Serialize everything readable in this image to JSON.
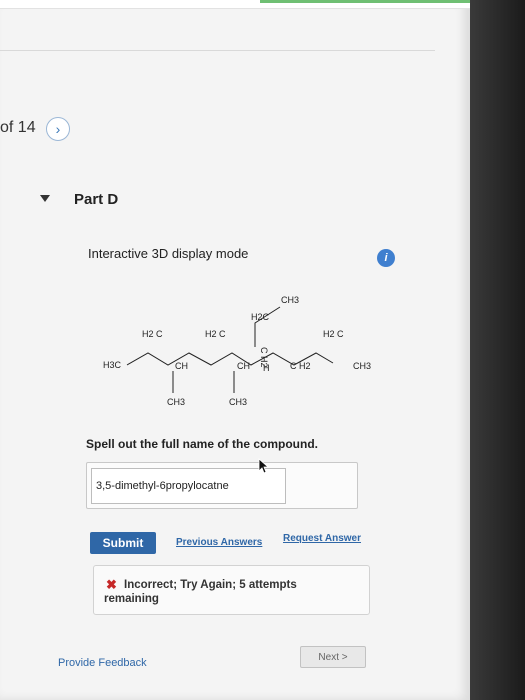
{
  "pager": {
    "current_label": "of 14"
  },
  "part": {
    "title": "Part D"
  },
  "display_mode": {
    "label": "Interactive 3D display mode",
    "info_icon": "i"
  },
  "molecule": {
    "labels": {
      "h3c_left": "H3C",
      "ch2_a": "H2 C",
      "ch_a": "CH",
      "ch3_a": "CH3",
      "ch2_b": "H2 C",
      "ch_b": "CH",
      "ch3_b": "CH3",
      "h2c_top": "H2C",
      "ch3_top": "CH3",
      "c_mid": "C H2",
      "h_mid": "H",
      "c_low": "C H2",
      "ch2_right": "H2 C",
      "ch3_right": "CH3"
    }
  },
  "question": {
    "prompt": "Spell out the full name of the compound."
  },
  "answer": {
    "value": "3,5-dimethyl-6propylocatne"
  },
  "actions": {
    "submit_label": "Submit",
    "previous_answers_label": "Previous Answers",
    "request_answer_label": "Request Answer"
  },
  "feedback": {
    "status": "Incorrect; Try Again; 5 attempts remaining",
    "icon": "close-icon"
  },
  "footer": {
    "provide_feedback_label": "Provide Feedback",
    "next_label": "Next >"
  },
  "colors": {
    "link": "#2f67a7",
    "submit_bg": "#2f67a7",
    "error": "#c62828",
    "info": "#3f7fcf"
  }
}
